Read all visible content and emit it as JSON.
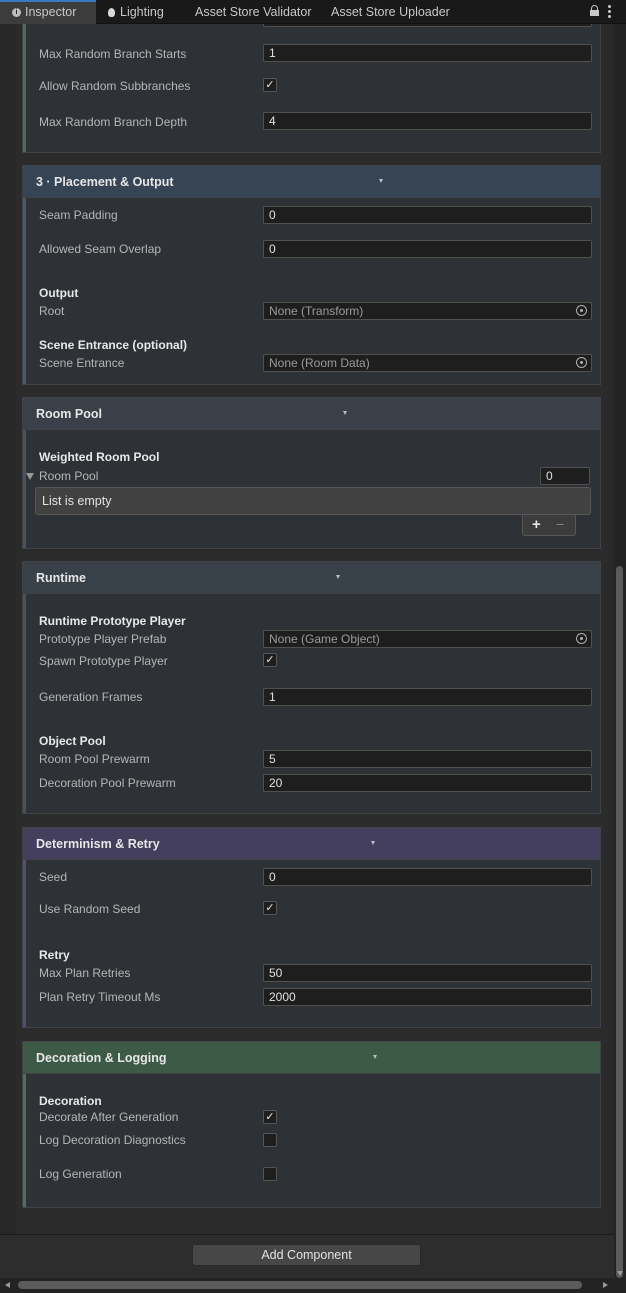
{
  "tabs": [
    {
      "label": "Inspector",
      "icon": "info-icon"
    },
    {
      "label": "Lighting",
      "icon": "lightbulb-icon"
    },
    {
      "label": "Asset Store Validator"
    },
    {
      "label": "Asset Store Uploader"
    }
  ],
  "sections": {
    "generation_tail": {
      "max_random_branch_starts": {
        "label": "Max Random Branch Starts",
        "value": "1"
      },
      "allow_random_subbranches": {
        "label": "Allow Random Subbranches",
        "checked": true
      },
      "max_random_branch_depth": {
        "label": "Max Random Branch Depth",
        "value": "4"
      }
    },
    "placement": {
      "title": "3 · Placement & Output",
      "seam_padding": {
        "label": "Seam Padding",
        "value": "0"
      },
      "allowed_seam_overlap": {
        "label": "Allowed Seam Overlap",
        "value": "0"
      },
      "output_group": "Output",
      "root": {
        "label": "Root",
        "value": "None (Transform)"
      },
      "scene_group": "Scene Entrance (optional)",
      "scene_entrance": {
        "label": "Scene Entrance",
        "value": "None (Room Data)"
      }
    },
    "room_pool": {
      "title": "Room Pool",
      "group": "Weighted Room Pool",
      "room_pool": {
        "label": "Room Pool",
        "count": "0"
      },
      "empty_text": "List is empty",
      "add_symbol": "+",
      "remove_symbol": "−"
    },
    "runtime": {
      "title": "Runtime",
      "group": "Runtime Prototype Player",
      "prototype_player_prefab": {
        "label": "Prototype Player Prefab",
        "value": "None (Game Object)"
      },
      "spawn_prototype_player": {
        "label": "Spawn Prototype Player",
        "checked": true
      },
      "generation_frames": {
        "label": "Generation Frames",
        "value": "1"
      },
      "object_pool_group": "Object Pool",
      "room_pool_prewarm": {
        "label": "Room Pool Prewarm",
        "value": "5"
      },
      "decoration_pool_prewarm": {
        "label": "Decoration Pool Prewarm",
        "value": "20"
      }
    },
    "determinism": {
      "title": "Determinism & Retry",
      "seed": {
        "label": "Seed",
        "value": "0"
      },
      "use_random_seed": {
        "label": "Use Random Seed",
        "checked": true
      },
      "retry_group": "Retry",
      "max_plan_retries": {
        "label": "Max Plan Retries",
        "value": "50"
      },
      "plan_retry_timeout_ms": {
        "label": "Plan Retry Timeout Ms",
        "value": "2000"
      }
    },
    "decoration": {
      "title": "Decoration & Logging",
      "group": "Decoration",
      "decorate_after_generation": {
        "label": "Decorate After Generation",
        "checked": true
      },
      "log_decoration_diagnostics": {
        "label": "Log Decoration Diagnostics",
        "checked": false
      },
      "log_generation": {
        "label": "Log Generation",
        "checked": false
      }
    }
  },
  "add_component": "Add Component",
  "colors": {
    "placement_header": "#364454",
    "room_pool_header": "#394048",
    "runtime_header": "#384048",
    "determinism_header": "#433f5c",
    "decoration_header": "#3d5a47",
    "tab_accent": "#3a79bb"
  }
}
